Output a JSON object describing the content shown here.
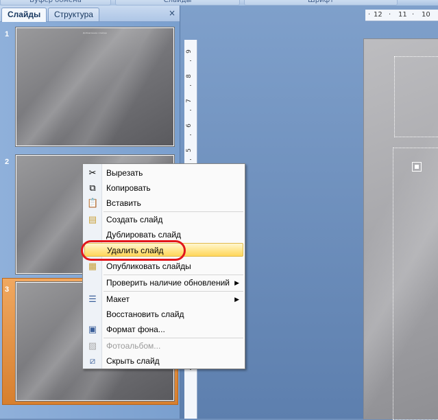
{
  "ribbon": {
    "groups": [
      "Буфер обмена",
      "Слайды",
      "Шрифт"
    ]
  },
  "left_pane": {
    "tabs": [
      {
        "label": "Слайды",
        "active": true
      },
      {
        "label": "Структура",
        "active": false
      }
    ],
    "close_glyph": "×",
    "slides": [
      {
        "number": "1",
        "title": "Добавление слайда"
      },
      {
        "number": "2",
        "title": ""
      },
      {
        "number": "3",
        "title": ""
      }
    ]
  },
  "rulers": {
    "horizontal": [
      "12",
      "11",
      "10"
    ],
    "vertical": [
      "9",
      "8",
      "7",
      "6",
      "5"
    ]
  },
  "context_menu": {
    "items": [
      {
        "label": "Вырезать",
        "icon": "scissors-icon",
        "enabled": true
      },
      {
        "label": "Копировать",
        "icon": "copy-icon",
        "enabled": true
      },
      {
        "label": "Вставить",
        "icon": "paste-icon",
        "enabled": true
      },
      {
        "label": "Создать слайд",
        "icon": "new-slide-icon",
        "enabled": true
      },
      {
        "label": "Дублировать слайд",
        "icon": "",
        "enabled": true
      },
      {
        "label": "Удалить слайд",
        "icon": "",
        "enabled": true,
        "highlighted": true
      },
      {
        "label": "Опубликовать слайды",
        "icon": "publish-slides-icon",
        "enabled": true
      },
      {
        "label": "Проверить наличие обновлений",
        "icon": "",
        "enabled": true,
        "submenu": true
      },
      {
        "label": "Макет",
        "icon": "layout-icon",
        "enabled": true,
        "submenu": true
      },
      {
        "label": "Восстановить слайд",
        "icon": "",
        "enabled": true
      },
      {
        "label": "Формат фона...",
        "icon": "format-background-icon",
        "enabled": true
      },
      {
        "label": "Фотоальбом...",
        "icon": "photo-album-icon",
        "enabled": false
      },
      {
        "label": "Скрыть слайд",
        "icon": "hide-slide-icon",
        "enabled": true
      }
    ]
  },
  "colors": {
    "highlight": "#ffe58c",
    "annotation_ring": "#e2161c",
    "selected_slide": "#e08a38"
  }
}
